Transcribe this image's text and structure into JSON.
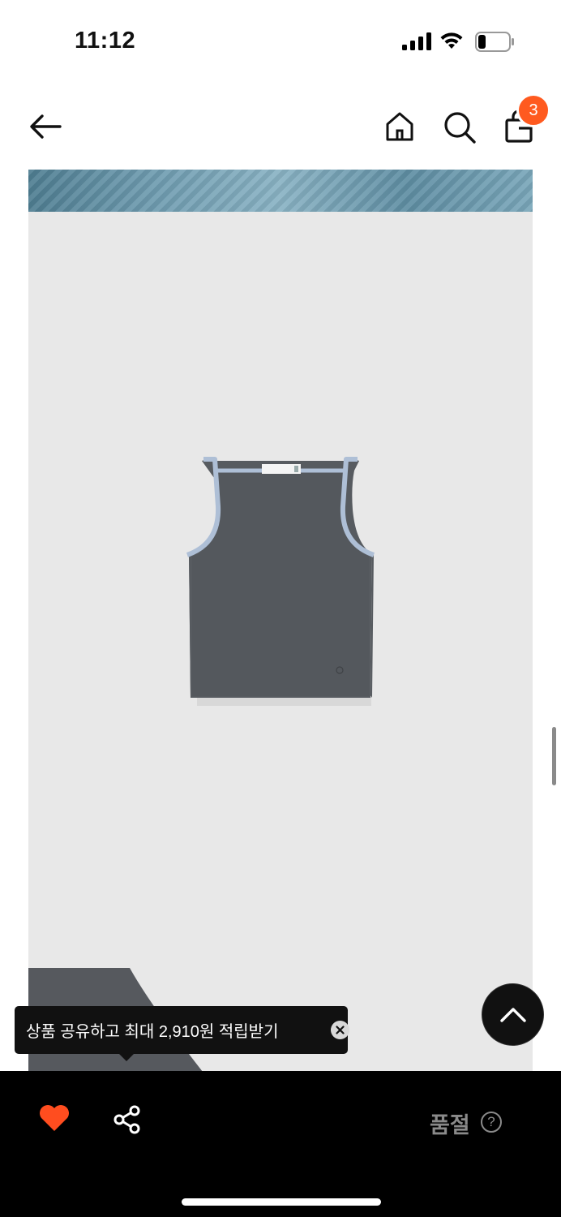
{
  "status_bar": {
    "time": "11:12"
  },
  "header": {
    "cart_count": "3"
  },
  "tooltip": {
    "text": "상품 공유하고 최대 2,910원 적립받기"
  },
  "bottom_bar": {
    "soldout_label": "품절",
    "help_glyph": "?"
  },
  "colors": {
    "accent": "#ff5a1f",
    "like": "#ff4d1f",
    "bar": "#000000",
    "panel": "#e8e8e8"
  },
  "icons": [
    "back-arrow-icon",
    "home-icon",
    "search-icon",
    "shopping-bag-icon",
    "heart-icon",
    "share-icon",
    "chevron-up-icon",
    "close-icon",
    "help-icon"
  ]
}
